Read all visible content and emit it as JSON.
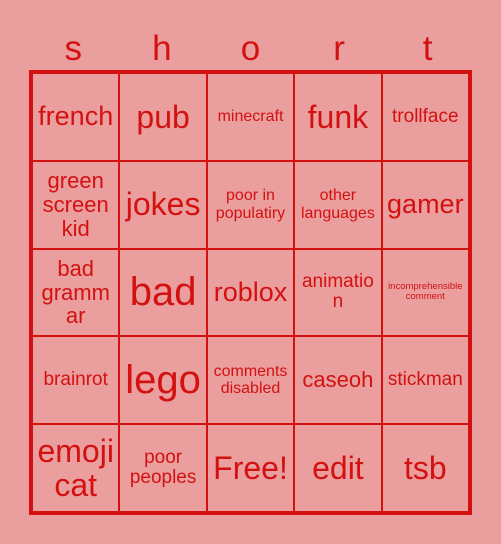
{
  "card": {
    "background_color": "#ea9e9e",
    "ink_color": "#d41111",
    "header_word": "short",
    "header_letters": [
      "s",
      "h",
      "o",
      "r",
      "t"
    ],
    "rows": [
      [
        {
          "text": "french",
          "size": "fs-xl"
        },
        {
          "text": "pub",
          "size": "fs-xxl"
        },
        {
          "text": "minecraft",
          "size": "fs-sm"
        },
        {
          "text": "funk",
          "size": "fs-xxl"
        },
        {
          "text": "trollface",
          "size": "fs-md"
        }
      ],
      [
        {
          "text": "green\nscreen\nkid",
          "size": "fs-lg"
        },
        {
          "text": "jokes",
          "size": "fs-xxl"
        },
        {
          "text": "poor in\npopulatiry",
          "size": "fs-sm"
        },
        {
          "text": "other\nlanguages",
          "size": "fs-sm"
        },
        {
          "text": "gamer",
          "size": "fs-xl"
        }
      ],
      [
        {
          "text": "bad\ngrammar",
          "size": "fs-lg"
        },
        {
          "text": "bad",
          "size": "fs-huge"
        },
        {
          "text": "roblox",
          "size": "fs-xl"
        },
        {
          "text": "animation",
          "size": "fs-md"
        },
        {
          "text": "incomprehensible\ncomment",
          "size": "fs-xxs"
        }
      ],
      [
        {
          "text": "brainrot",
          "size": "fs-md"
        },
        {
          "text": "lego",
          "size": "fs-huge"
        },
        {
          "text": "comments\ndisabled",
          "size": "fs-sm"
        },
        {
          "text": "caseoh",
          "size": "fs-lg"
        },
        {
          "text": "stickman",
          "size": "fs-md"
        }
      ],
      [
        {
          "text": "emoji\ncat",
          "size": "fs-xxl"
        },
        {
          "text": "poor\npeoples",
          "size": "fs-md"
        },
        {
          "text": "Free!",
          "size": "fs-xxl"
        },
        {
          "text": "edit",
          "size": "fs-xxl"
        },
        {
          "text": "tsb",
          "size": "fs-xxl"
        }
      ]
    ]
  }
}
